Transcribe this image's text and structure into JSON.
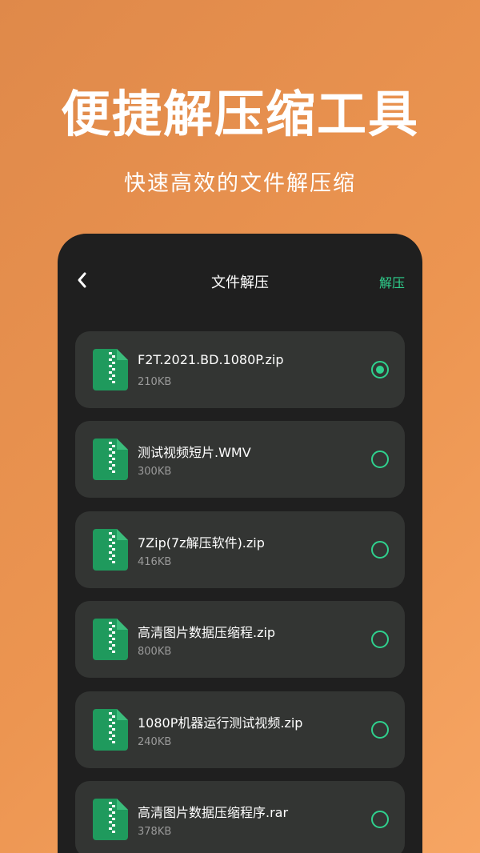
{
  "promo": {
    "headline": "便捷解压缩工具",
    "subline": "快速高效的文件解压缩"
  },
  "nav": {
    "back_icon": "chevron-left-icon",
    "title": "文件解压",
    "action_label": "解压"
  },
  "colors": {
    "accent": "#2fd18e",
    "file_icon": "#1f9a5d",
    "card": "#333533",
    "screen": "#1f1f1f"
  },
  "files": [
    {
      "name": "F2T.2021.BD.1080P.zip",
      "size": "210KB",
      "selected": true
    },
    {
      "name": "测试视频短片.WMV",
      "size": "300KB",
      "selected": false
    },
    {
      "name": "7Zip(7z解压软件).zip",
      "size": "416KB",
      "selected": false
    },
    {
      "name": "高清图片数据压缩程.zip",
      "size": "800KB",
      "selected": false
    },
    {
      "name": "1080P机器运行测试视频.zip",
      "size": "240KB",
      "selected": false
    },
    {
      "name": "高清图片数据压缩程序.rar",
      "size": "378KB",
      "selected": false
    }
  ]
}
